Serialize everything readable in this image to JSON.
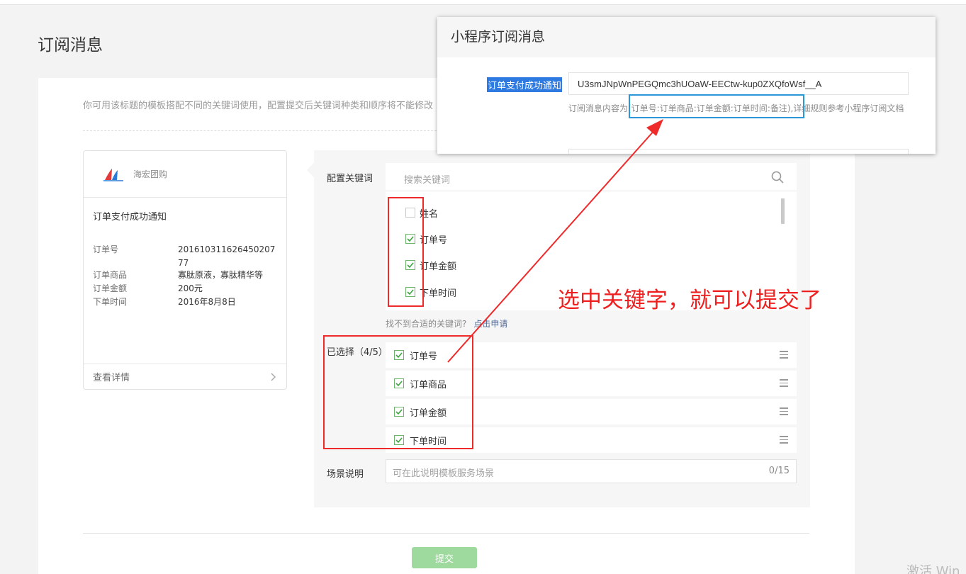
{
  "page": {
    "title": "订阅消息",
    "notice": "你可用该标题的模板搭配不同的关键词使用，配置提交后关键词种类和顺序将不能修改"
  },
  "preview_card": {
    "brand": "海宏团购",
    "title": "订单支付成功通知",
    "fields": [
      {
        "key": "订单号",
        "value": "20161031162645020777"
      },
      {
        "key": "订单商品",
        "value": "寡肽原液，寡肽精华等"
      },
      {
        "key": "订单金额",
        "value": "200元"
      },
      {
        "key": "下单时间",
        "value": "2016年8月8日"
      }
    ],
    "footer_link": "查看详情"
  },
  "config": {
    "keywords_label": "配置关键词",
    "search_placeholder": "搜索关键词",
    "keywords": [
      {
        "label": "姓名",
        "checked": false
      },
      {
        "label": "订单号",
        "checked": true
      },
      {
        "label": "订单金额",
        "checked": true
      },
      {
        "label": "下单时间",
        "checked": true
      }
    ],
    "missing_text": "找不到合适的关键词?",
    "missing_link": "点击申请",
    "selected_label": "已选择（4/5）",
    "selected": [
      {
        "label": "订单号"
      },
      {
        "label": "订单商品"
      },
      {
        "label": "订单金额"
      },
      {
        "label": "下单时间"
      }
    ],
    "scene_label": "场景说明",
    "scene_placeholder": "可在此说明模板服务场景",
    "scene_count": "0/15"
  },
  "submit_label": "提交",
  "popup": {
    "title": "小程序订阅消息",
    "field_label": "订单支付成功通知",
    "template_id": "U3smJNpWnPEGQmc3hUOaW-EECtw-kup0ZXQfoWsf__A",
    "description": "订阅消息内容为(订单号:订单商品:订单金额:订单时间:备注),详细规则参考小程序订阅文档"
  },
  "annotation": "选中关键字，就可以提交了",
  "watermark": "激活 Win",
  "colors": {
    "accent_green": "#07c160",
    "check_green": "#6ab76a",
    "submit_disabled": "#9ed99e",
    "annotation_red": "#f01f1f",
    "highlight_blue": "#2a98d8",
    "link_blue": "#576b95"
  }
}
